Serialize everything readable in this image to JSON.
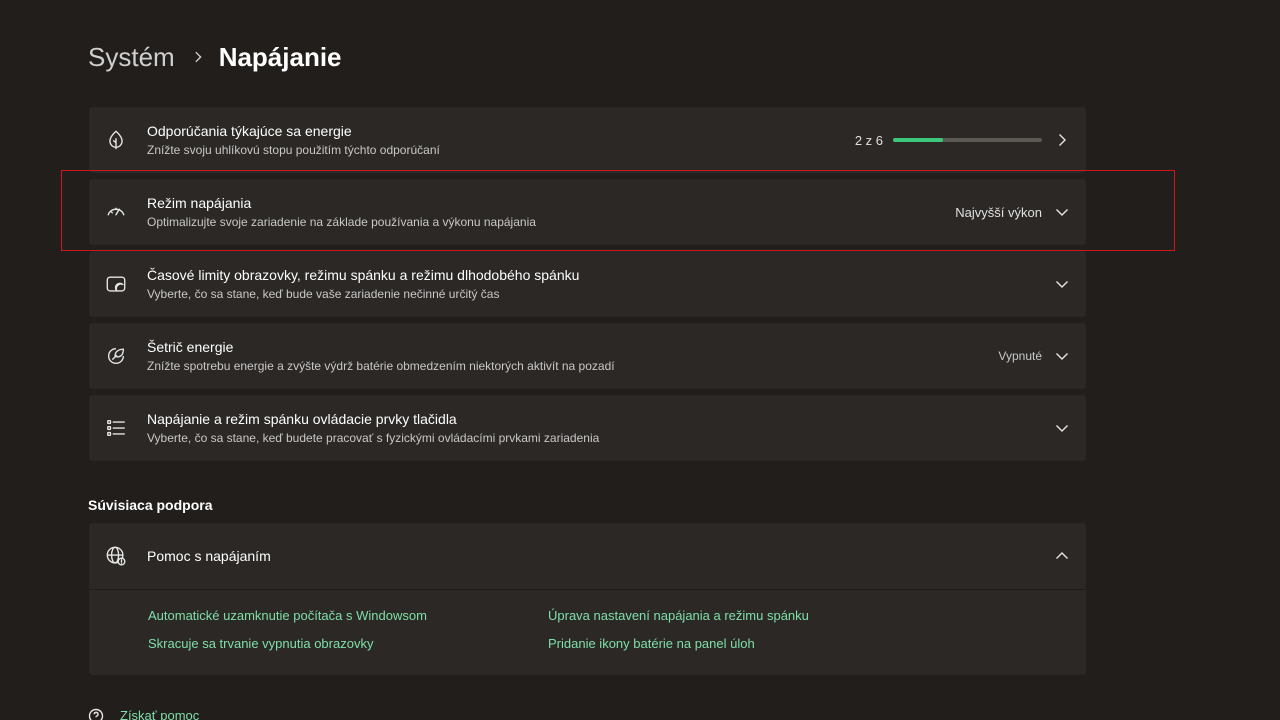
{
  "breadcrumb": {
    "parent": "Systém",
    "current": "Napájanie"
  },
  "power_settings": [
    {
      "title": "Odporúčania týkajúce sa energie",
      "subtitle": "Znížte svoju uhlíkovú stopu použitím týchto odporúčaní",
      "icon": "leaf-icon",
      "progress_label": "2 z 6",
      "progress_value": 2,
      "progress_max": 6
    },
    {
      "title": "Režim napájania",
      "subtitle": "Optimalizujte svoje zariadenie na základe používania a výkonu napájania",
      "icon": "speedometer-icon",
      "value": "Najvyšší výkon"
    },
    {
      "title": "Časové limity obrazovky, režimu spánku a režimu dlhodobého spánku",
      "subtitle": "Vyberte, čo sa stane, keď bude vaše zariadenie nečinné určitý čas",
      "icon": "screen-sleep-icon"
    },
    {
      "title": "Šetrič energie",
      "subtitle": "Znížte spotrebu energie a zvýšte výdrž batérie obmedzením niektorých aktivít na pozadí",
      "icon": "energy-saver-icon",
      "value": "Vypnuté"
    },
    {
      "title": "Napájanie a režim spánku ovládacie prvky tlačidla",
      "subtitle": "Vyberte, čo sa stane, keď budete pracovať s fyzickými ovládacími prvkami zariadenia",
      "icon": "list-icon"
    }
  ],
  "related": {
    "section_title": "Súvisiaca podpora",
    "help_title": "Pomoc s napájaním",
    "links": [
      "Automatické uzamknutie počítača s Windowsom",
      "Úprava nastavení napájania a režimu spánku",
      "Skracuje sa trvanie vypnutia obrazovky",
      "Pridanie ikony batérie na panel úloh"
    ]
  },
  "get_help": "Získať pomoc",
  "colors": {
    "background": "#211e1b",
    "card": "#2b2825",
    "accent_green": "#3cc87a",
    "link": "#7fdfa8",
    "highlight_red": "#d0161c"
  }
}
